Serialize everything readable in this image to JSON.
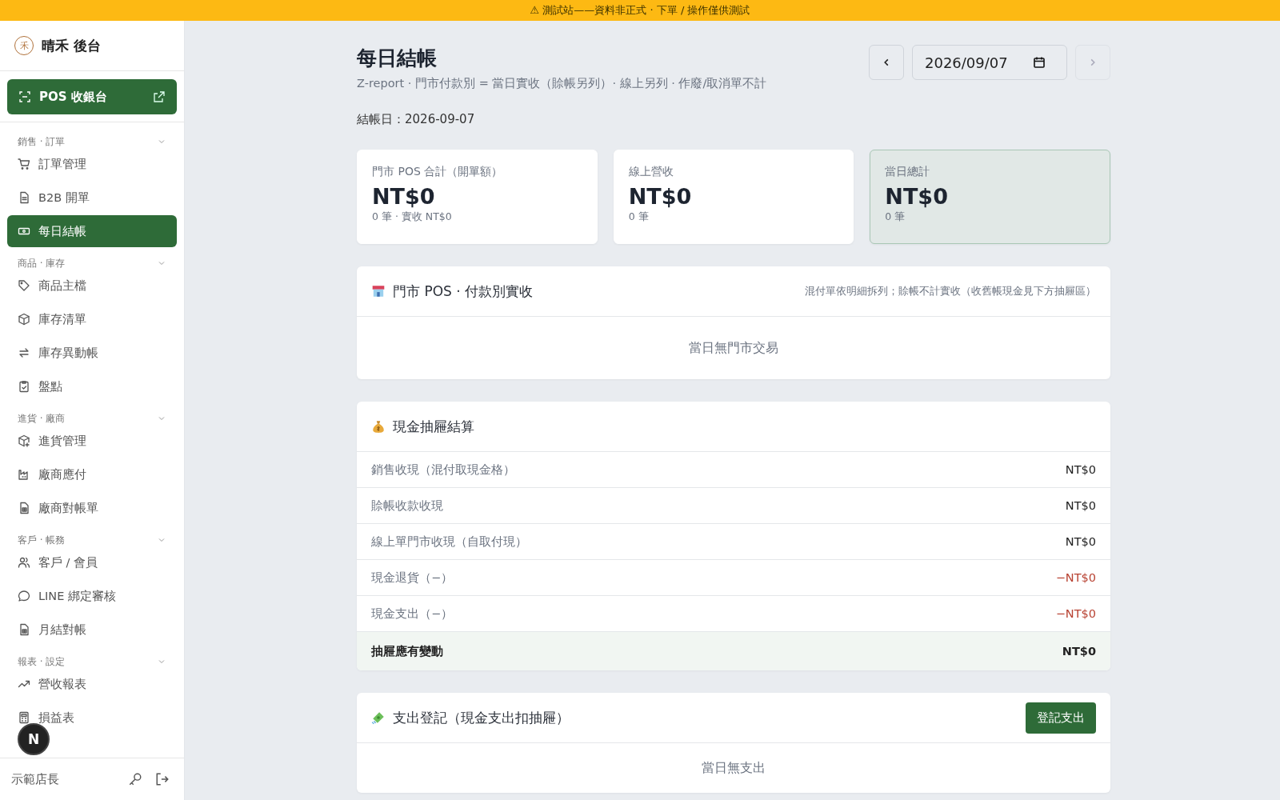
{
  "banner": {
    "icon": "⚠",
    "text": "測試站——資料非正式 · 下單 / 操作僅供測試"
  },
  "sidebar": {
    "brand": {
      "logo": "禾",
      "name": "晴禾 後台"
    },
    "pos_button": {
      "label": "POS 收銀台"
    },
    "groups": [
      {
        "label": "銷售 · 訂單",
        "expanded": true,
        "items": [
          {
            "label": "訂單管理",
            "selected": false
          },
          {
            "label": "B2B 開單",
            "selected": false
          },
          {
            "label": "每日結帳",
            "selected": true
          }
        ]
      },
      {
        "label": "商品 · 庫存",
        "expanded": true,
        "items": [
          {
            "label": "商品主檔",
            "selected": false
          },
          {
            "label": "庫存清單",
            "selected": false
          },
          {
            "label": "庫存異動帳",
            "selected": false
          },
          {
            "label": "盤點",
            "selected": false
          }
        ]
      },
      {
        "label": "進貨 · 廠商",
        "expanded": true,
        "items": [
          {
            "label": "進貨管理",
            "selected": false
          },
          {
            "label": "廠商應付",
            "selected": false
          },
          {
            "label": "廠商對帳單",
            "selected": false
          }
        ]
      },
      {
        "label": "客戶 · 帳務",
        "expanded": true,
        "items": [
          {
            "label": "客戶 / 會員",
            "selected": false
          },
          {
            "label": "LINE 綁定審核",
            "selected": false
          },
          {
            "label": "月結對帳",
            "selected": false
          }
        ]
      },
      {
        "label": "報表 · 設定",
        "expanded": true,
        "items": [
          {
            "label": "營收報表",
            "selected": false
          },
          {
            "label": "損益表",
            "selected": false
          }
        ]
      }
    ],
    "user": {
      "name": "示範店長"
    },
    "dev_badge": "N"
  },
  "header": {
    "title": "每日結帳",
    "subtitle": "Z-report · 門市付款別 = 當日實收（賒帳另列）· 線上另列 · 作廢/取消單不計",
    "date_line": "結帳日：2026-09-07",
    "date_picker": {
      "value": "2026/09/07",
      "prev_disabled": false,
      "next_disabled": true
    }
  },
  "summary_cards": [
    {
      "label": "門市 POS 合計（開單額）",
      "amount": "NT$0",
      "detail": "0 筆 · 實收 NT$0",
      "highlighted": false
    },
    {
      "label": "線上營收",
      "amount": "NT$0",
      "detail": "0 筆",
      "highlighted": false
    },
    {
      "label": "當日總計",
      "amount": "NT$0",
      "detail": "0 筆",
      "highlighted": true
    }
  ],
  "pos_section": {
    "title": "門市 POS · 付款別實收",
    "note": "混付單依明細拆列；賒帳不計實收（收舊帳現金見下方抽屜區）",
    "empty": "當日無門市交易"
  },
  "drawer_section": {
    "title": "現金抽屜結算",
    "rows": [
      {
        "label": "銷售收現（混付取現金格）",
        "amount": "NT$0",
        "kind": "normal"
      },
      {
        "label": "賒帳收款收現",
        "amount": "NT$0",
        "kind": "normal"
      },
      {
        "label": "線上單門市收現（自取付現）",
        "amount": "NT$0",
        "kind": "normal"
      },
      {
        "label": "現金退貨（−）",
        "amount": "−NT$0",
        "kind": "negative"
      },
      {
        "label": "現金支出（−）",
        "amount": "−NT$0",
        "kind": "negative"
      },
      {
        "label": "抽屜應有變動",
        "amount": "NT$0",
        "kind": "total"
      }
    ]
  },
  "expense_section": {
    "title": "支出登記（現金支出扣抽屜）",
    "button": "登記支出",
    "empty": "當日無支出"
  }
}
